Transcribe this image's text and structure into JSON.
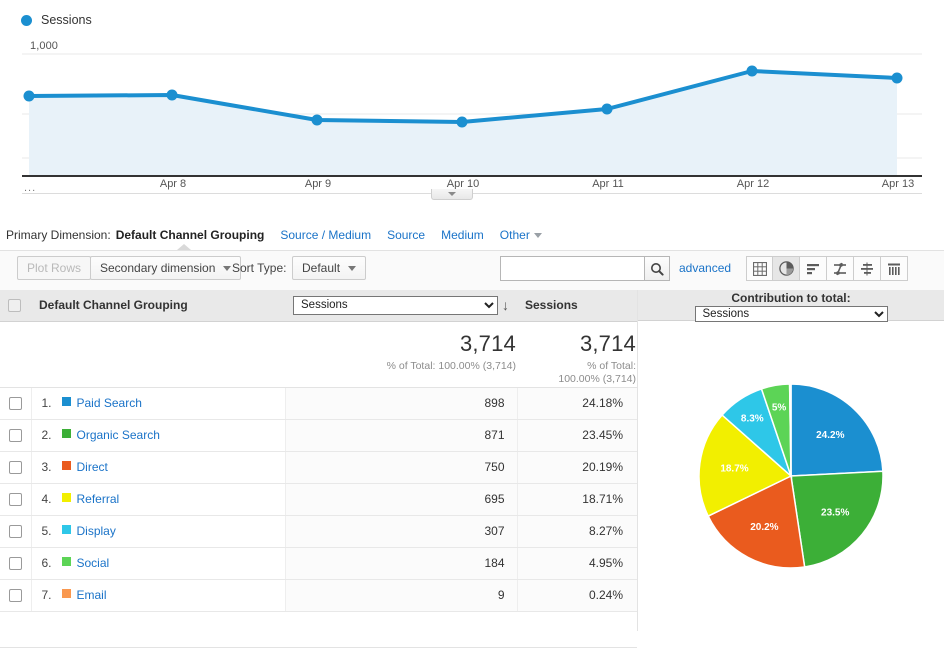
{
  "timeline": {
    "legend_label": "Sessions",
    "y_axis": [
      "1,000",
      "500"
    ],
    "x_ellipsis": "...",
    "x_ticks": [
      "Apr 8",
      "Apr 9",
      "Apr 10",
      "Apr 11",
      "Apr 12",
      "Apr 13"
    ],
    "line_color": "#1b8fd0",
    "area_color": "#e8f2f9"
  },
  "primary_dimension": {
    "label": "Primary Dimension:",
    "active": "Default Channel Grouping",
    "links": [
      "Source / Medium",
      "Source",
      "Medium"
    ],
    "other": "Other"
  },
  "toolbar": {
    "plot_rows": "Plot Rows",
    "secondary_dimension": "Secondary dimension",
    "sort_type_label": "Sort Type:",
    "sort_type_value": "Default",
    "search_value": "",
    "search_placeholder": "",
    "advanced": "advanced",
    "view_toggles": [
      {
        "name": "table-view-icon",
        "active": false
      },
      {
        "name": "pie-chart-view-icon",
        "active": true
      },
      {
        "name": "bar-chart-view-icon",
        "active": false
      },
      {
        "name": "performance-view-icon",
        "active": false
      },
      {
        "name": "comparison-view-icon",
        "active": false
      },
      {
        "name": "pivot-view-icon",
        "active": false
      }
    ]
  },
  "table": {
    "headers": {
      "dimension": "Default Channel Grouping",
      "metric_select_value": "Sessions",
      "metric_select_options": [
        "Sessions"
      ],
      "metric2": "Sessions"
    },
    "totals": {
      "m1_value": "3,714",
      "m1_sub": "% of Total: 100.00% (3,714)",
      "m2_value": "3,714",
      "m2_sub_line1": "% of Total:",
      "m2_sub_line2": "100.00% (3,714)"
    },
    "rows": [
      {
        "rank": "1.",
        "label": "Paid Search",
        "color": "#1b8fd0",
        "sessions": "898",
        "percent": "24.18%"
      },
      {
        "rank": "2.",
        "label": "Organic Search",
        "color": "#3caf37",
        "sessions": "871",
        "percent": "23.45%"
      },
      {
        "rank": "3.",
        "label": "Direct",
        "color": "#ea5b1e",
        "sessions": "750",
        "percent": "20.19%"
      },
      {
        "rank": "4.",
        "label": "Referral",
        "color": "#f2ef00",
        "sessions": "695",
        "percent": "18.71%"
      },
      {
        "rank": "5.",
        "label": "Display",
        "color": "#2ec7e8",
        "sessions": "307",
        "percent": "8.27%"
      },
      {
        "rank": "6.",
        "label": "Social",
        "color": "#5cd456",
        "sessions": "184",
        "percent": "4.95%"
      },
      {
        "rank": "7.",
        "label": "Email",
        "color": "#f9984f",
        "sessions": "9",
        "percent": "0.24%"
      }
    ]
  },
  "contribution": {
    "title": "Contribution to total:",
    "select_value": "Sessions",
    "select_options": [
      "Sessions"
    ]
  },
  "chart_data": [
    {
      "type": "line",
      "title": "Sessions",
      "xlabel": "",
      "ylabel": "Sessions",
      "x": [
        "...",
        "Apr 8",
        "Apr 9",
        "Apr 10",
        "Apr 11",
        "Apr 12",
        "Apr 13"
      ],
      "values": [
        610,
        612,
        455,
        450,
        540,
        718,
        690
      ],
      "ylim": [
        0,
        1100
      ],
      "yticks": [
        500,
        1000
      ],
      "grid": true,
      "legend": [
        "Sessions"
      ],
      "colors": [
        "#1b8fd0"
      ],
      "area_fill": true
    },
    {
      "type": "pie",
      "title": "Contribution to total: Sessions",
      "labels": [
        "Paid Search",
        "Organic Search",
        "Direct",
        "Referral",
        "Display",
        "Social",
        "Email"
      ],
      "values": [
        898,
        871,
        750,
        695,
        307,
        184,
        9
      ],
      "data_labels": [
        "24.2%",
        "23.5%",
        "20.2%",
        "18.7%",
        "8.3%",
        "5%",
        ""
      ],
      "colors": [
        "#1b8fd0",
        "#3caf37",
        "#ea5b1e",
        "#f2ef00",
        "#2ec7e8",
        "#5cd456",
        "#f9984f"
      ],
      "legend": "table"
    }
  ]
}
